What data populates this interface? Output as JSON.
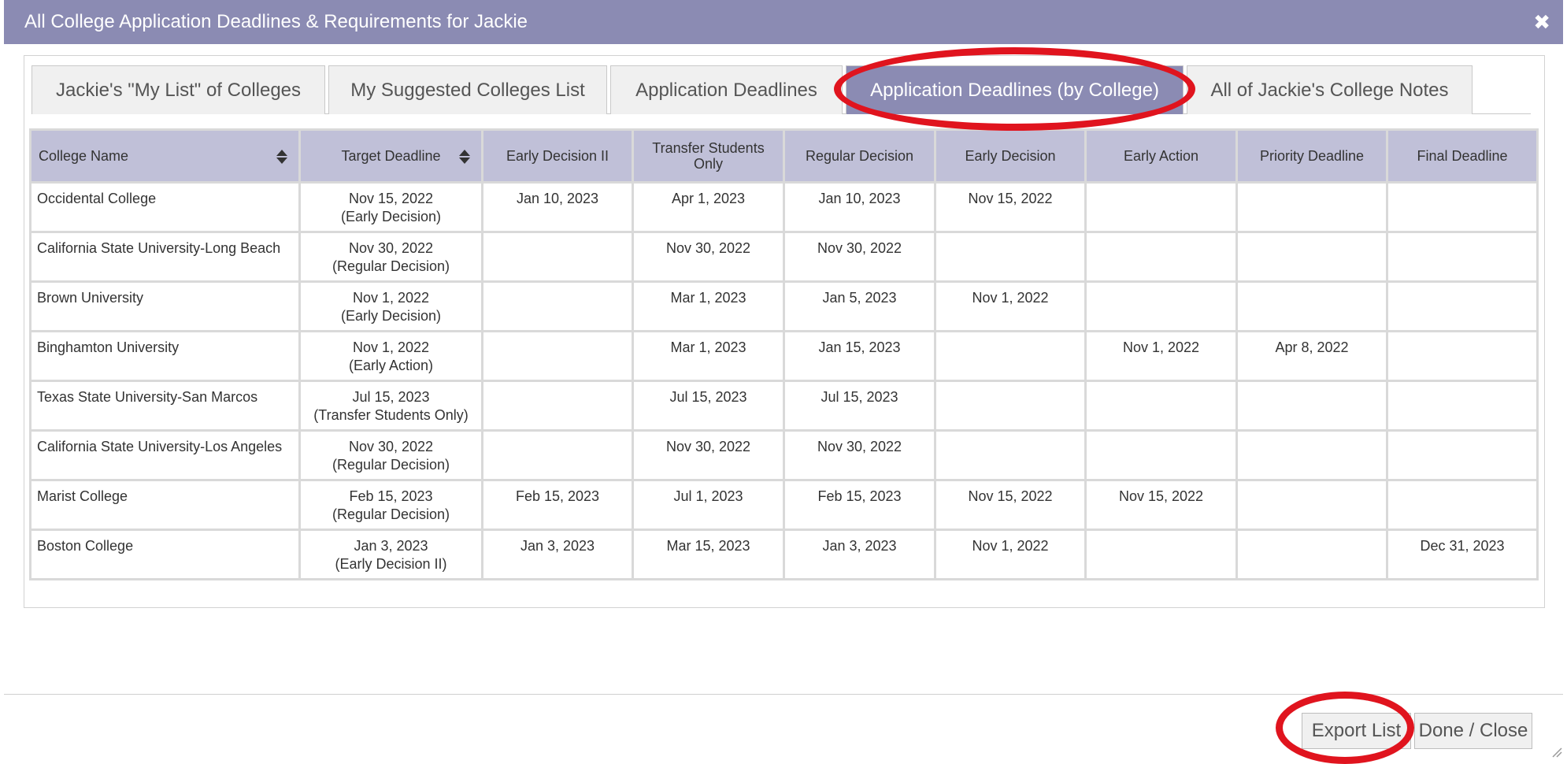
{
  "dialog": {
    "title": "All College Application Deadlines & Requirements for Jackie",
    "close_glyph": "✖"
  },
  "tabs": [
    {
      "label": "Jackie's \"My List\" of Colleges",
      "active": false
    },
    {
      "label": "My Suggested Colleges List",
      "active": false
    },
    {
      "label": "Application Deadlines",
      "active": false
    },
    {
      "label": "Application Deadlines (by College)",
      "active": true
    },
    {
      "label": "All of Jackie's College Notes",
      "active": false
    }
  ],
  "table": {
    "headers": [
      "College Name",
      "Target Deadline",
      "Early Decision II",
      "Transfer Students Only",
      "Regular Decision",
      "Early Decision",
      "Early Action",
      "Priority Deadline",
      "Final Deadline"
    ],
    "rows": [
      {
        "name": "Occidental College",
        "target": "Nov 15, 2022",
        "target_type": "(Early Decision)",
        "ed2": "Jan 10, 2023",
        "transfer": "Apr 1, 2023",
        "regular": "Jan 10, 2023",
        "ed": "Nov 15, 2022",
        "ea": "",
        "priority": "",
        "final": ""
      },
      {
        "name": "California State University-Long Beach",
        "target": "Nov 30, 2022",
        "target_type": "(Regular Decision)",
        "ed2": "",
        "transfer": "Nov 30, 2022",
        "regular": "Nov 30, 2022",
        "ed": "",
        "ea": "",
        "priority": "",
        "final": ""
      },
      {
        "name": "Brown University",
        "target": "Nov 1, 2022",
        "target_type": "(Early Decision)",
        "ed2": "",
        "transfer": "Mar 1, 2023",
        "regular": "Jan 5, 2023",
        "ed": "Nov 1, 2022",
        "ea": "",
        "priority": "",
        "final": ""
      },
      {
        "name": "Binghamton University",
        "target": "Nov 1, 2022",
        "target_type": "(Early Action)",
        "ed2": "",
        "transfer": "Mar 1, 2023",
        "regular": "Jan 15, 2023",
        "ed": "",
        "ea": "Nov 1, 2022",
        "priority": "Apr 8, 2022",
        "final": ""
      },
      {
        "name": "Texas State University-San Marcos",
        "target": "Jul 15, 2023",
        "target_type": "(Transfer Students Only)",
        "ed2": "",
        "transfer": "Jul 15, 2023",
        "regular": "Jul 15, 2023",
        "ed": "",
        "ea": "",
        "priority": "",
        "final": ""
      },
      {
        "name": "California State University-Los Angeles",
        "target": "Nov 30, 2022",
        "target_type": "(Regular Decision)",
        "ed2": "",
        "transfer": "Nov 30, 2022",
        "regular": "Nov 30, 2022",
        "ed": "",
        "ea": "",
        "priority": "",
        "final": ""
      },
      {
        "name": "Marist College",
        "target": "Feb 15, 2023",
        "target_type": "(Regular Decision)",
        "ed2": "Feb 15, 2023",
        "transfer": "Jul 1, 2023",
        "regular": "Feb 15, 2023",
        "ed": "Nov 15, 2022",
        "ea": "Nov 15, 2022",
        "priority": "",
        "final": ""
      },
      {
        "name": "Boston College",
        "target": "Jan 3, 2023",
        "target_type": "(Early Decision II)",
        "ed2": "Jan 3, 2023",
        "transfer": "Mar 15, 2023",
        "regular": "Jan 3, 2023",
        "ed": "Nov 1, 2022",
        "ea": "",
        "priority": "",
        "final": "Dec 31, 2023"
      }
    ]
  },
  "footer": {
    "export_label": "Export List",
    "done_label": "Done / Close"
  },
  "colors": {
    "title_bar": "#8b8bb3",
    "active_tab": "#8b8bb3",
    "header_cell": "#c0c0d8",
    "highlight_ring": "#e0141e"
  }
}
